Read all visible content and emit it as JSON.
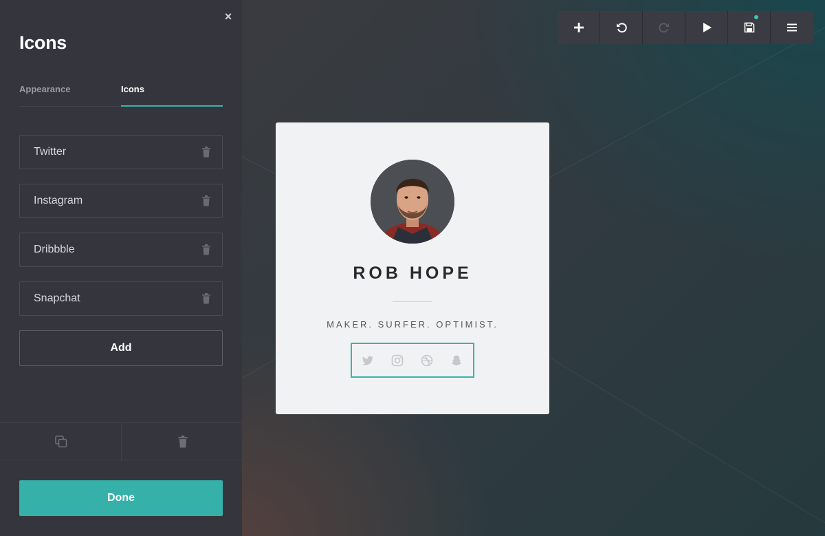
{
  "panel": {
    "title": "Icons",
    "close_symbol": "×",
    "tabs": [
      {
        "label": "Appearance",
        "active": false
      },
      {
        "label": "Icons",
        "active": true
      }
    ],
    "icon_items": [
      {
        "label": "Twitter"
      },
      {
        "label": "Instagram"
      },
      {
        "label": "Dribbble"
      },
      {
        "label": "Snapchat"
      }
    ],
    "add_label": "Add",
    "footer_actions": [
      "duplicate-icon",
      "trash-icon"
    ],
    "done_label": "Done"
  },
  "toolbar": {
    "buttons": [
      "plus-icon",
      "undo-icon",
      "redo-icon",
      "play-icon",
      "save-icon",
      "menu-icon"
    ],
    "save_unsaved_indicator": true,
    "redo_disabled": true
  },
  "card": {
    "name": "ROB HOPE",
    "tagline": "MAKER. SURFER. OPTIMIST.",
    "social_icons": [
      "twitter-icon",
      "instagram-icon",
      "dribbble-icon",
      "snapchat-icon"
    ]
  },
  "colors": {
    "accent": "#35b1a9",
    "sidebar_bg": "#35363d",
    "card_bg": "#f1f2f3",
    "toolbar_bg": "#3b3c43"
  }
}
